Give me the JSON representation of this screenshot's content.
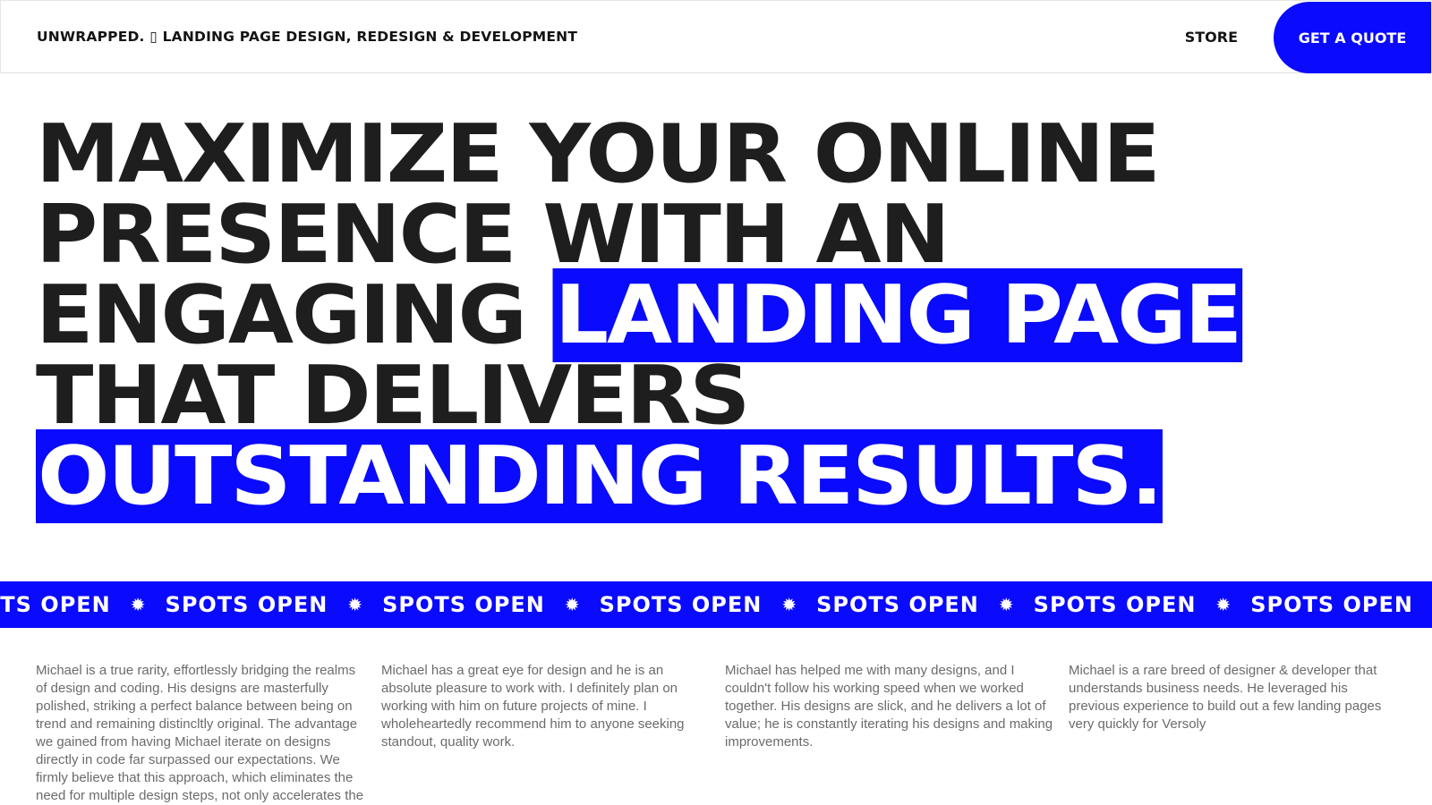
{
  "header": {
    "brand": "UNWRAPPED. ▯ LANDING PAGE DESIGN, REDESIGN & DEVELOPMENT",
    "nav_store": "STORE",
    "cta_label": "GET A QUOTE"
  },
  "hero": {
    "line1": "MAXIMIZE YOUR ONLINE",
    "line2": "PRESENCE WITH AN",
    "line3_plain": "ENGAGING ",
    "line3_highlight": "LANDING PAGE",
    "line4": "THAT DELIVERS",
    "line5_highlight": "OUTSTANDING RESULTS."
  },
  "ticker": {
    "items": [
      "SPOTS OPEN",
      "SPOTS OPEN",
      "SPOTS OPEN",
      "SPOTS OPEN",
      "SPOTS OPEN",
      "SPOTS OPEN",
      "SPOTS OPEN"
    ],
    "separator_icon": "sunburst-icon"
  },
  "testimonials": [
    "Michael is a true rarity, effortlessly bridging the realms of design and coding. His designs are masterfully polished, striking a perfect balance between being on trend and remaining distincltly original. The advantage we gained from having Michael iterate on designs directly in code far surpassed our expectations. We firmly believe that this approach, which eliminates the need for multiple design steps, not only accelerates the",
    "Michael has a great eye for design and he is an absolute pleasure to work with. I definitely plan on working with him on future projects of mine. I wholeheartedly recommend him to anyone seeking standout, quality work.",
    "Michael has helped me with many designs, and I couldn't follow his working speed when we worked together. His designs are slick, and he delivers a lot of value; he is constantly iterating his designs and making improvements.",
    "Michael is a rare breed of designer & developer that understands business needs. He leveraged his previous experience to build out a few landing pages very quickly for Versoly"
  ],
  "colors": {
    "accent": "#0a0afc",
    "text": "#1e1e1e",
    "muted": "#6b6b6b"
  }
}
